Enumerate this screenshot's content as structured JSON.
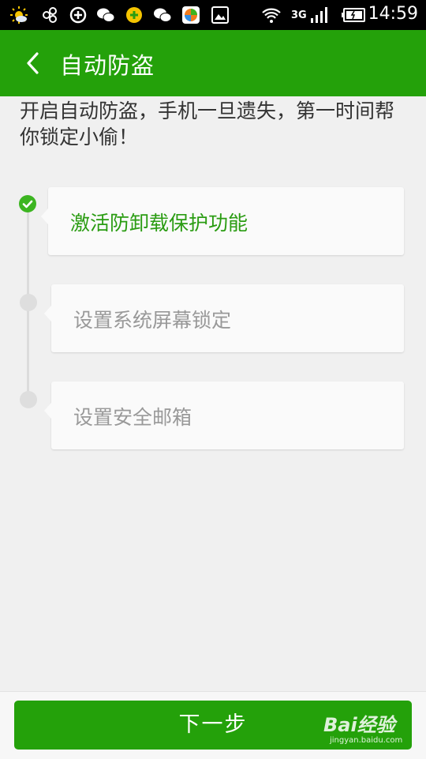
{
  "status_bar": {
    "time": "14:59",
    "network": "3G",
    "icons": [
      "weather-sun-icon",
      "link-icon",
      "plus-circle-icon",
      "wechat-icon",
      "game-icon",
      "wechat-icon",
      "app-store-icon",
      "gallery-icon",
      "wifi-icon",
      "signal-icon",
      "battery-icon"
    ]
  },
  "header": {
    "title": "自动防盗"
  },
  "intro_text": "开启自动防盗，手机一旦遗失，第一时间帮你锁定小偷！",
  "steps": [
    {
      "label": "激活防卸载保护功能",
      "status": "done"
    },
    {
      "label": "设置系统屏幕锁定",
      "status": "pending"
    },
    {
      "label": "设置安全邮箱",
      "status": "pending"
    }
  ],
  "next_button": {
    "label": "下一步"
  },
  "watermark": {
    "text": "Bai经验",
    "sub": "jingyan.baidu.com"
  },
  "colors": {
    "brand_green": "#24a10a",
    "check_green": "#3cb521",
    "inactive_gray": "#999999"
  }
}
